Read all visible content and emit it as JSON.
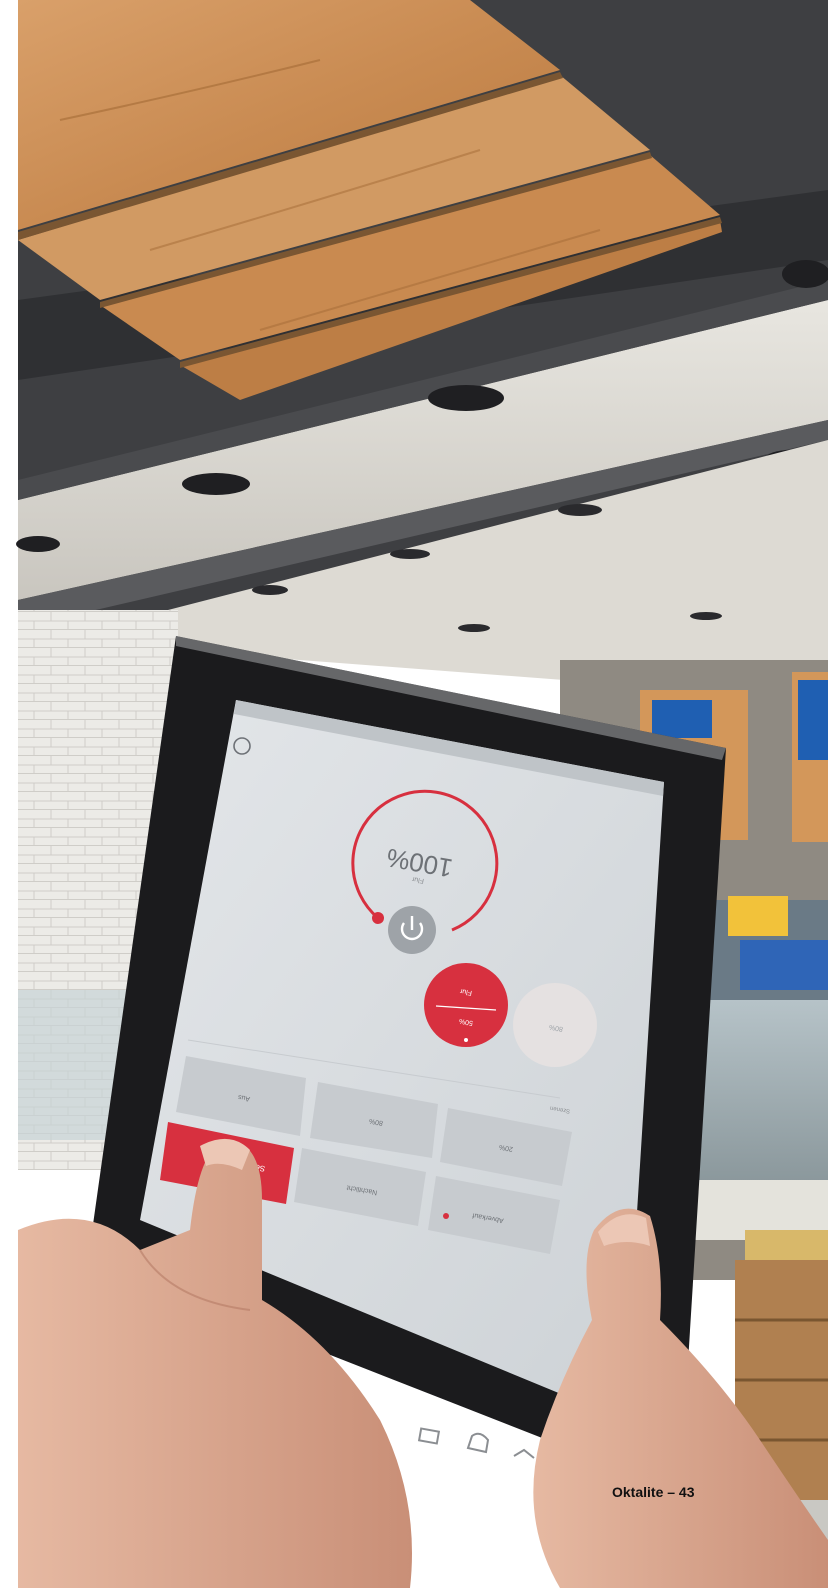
{
  "photo": {
    "colors": {
      "ceiling_wood": "#c98b52",
      "ceiling_dark": "#3b3c3f",
      "soffit": "#dedcd5",
      "tile_wall": "#ebeae6",
      "tablet_bezel": "#1b1b1d",
      "screen_bg": "#d9dde0",
      "accent_red": "#d7303f",
      "skin": "#dcad95"
    },
    "tablet": {
      "dial_value": "100%",
      "dial_sub": "Flur",
      "dial_level": 1.0,
      "power_icon": "power-icon",
      "red_circle_top": "Flur",
      "red_circle_bottom": "50%",
      "grey_circle_label": "80%",
      "tiles": [
        {
          "label": "Aus"
        },
        {
          "label": "80%"
        },
        {
          "label": "20%"
        },
        {
          "label": "Service"
        },
        {
          "label": "Nachtlicht"
        },
        {
          "label": "Abverkauf"
        }
      ],
      "section_label": "Szenen"
    }
  },
  "footer": {
    "text": "Oktalite – 43"
  }
}
